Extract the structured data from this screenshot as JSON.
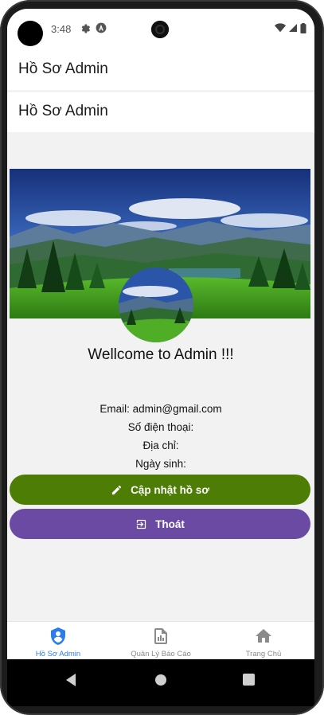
{
  "status": {
    "time": "3:48"
  },
  "appbar": {
    "title": "Hồ Sơ Admin"
  },
  "subbar": {
    "title": "Hồ Sơ Admin"
  },
  "profile": {
    "welcome": "Wellcome to Admin !!!",
    "email": "Email: admin@gmail.com",
    "phone": "Số điện thoại:",
    "address": "Địa chỉ:",
    "birthday": "Ngày sinh:"
  },
  "buttons": {
    "update": "Cập nhật hồ sơ",
    "logout": "Thoát"
  },
  "bottom_nav": [
    {
      "label": "Hồ Sơ Admin",
      "icon": "admin-shield-icon",
      "active": true
    },
    {
      "label": "Quản Lý Báo Cáo",
      "icon": "report-icon",
      "active": false
    },
    {
      "label": "Trang Chủ",
      "icon": "home-icon",
      "active": false
    }
  ],
  "colors": {
    "update_button": "#4e7d05",
    "logout_button": "#6a4aa3",
    "active_nav": "#2b7de9"
  }
}
